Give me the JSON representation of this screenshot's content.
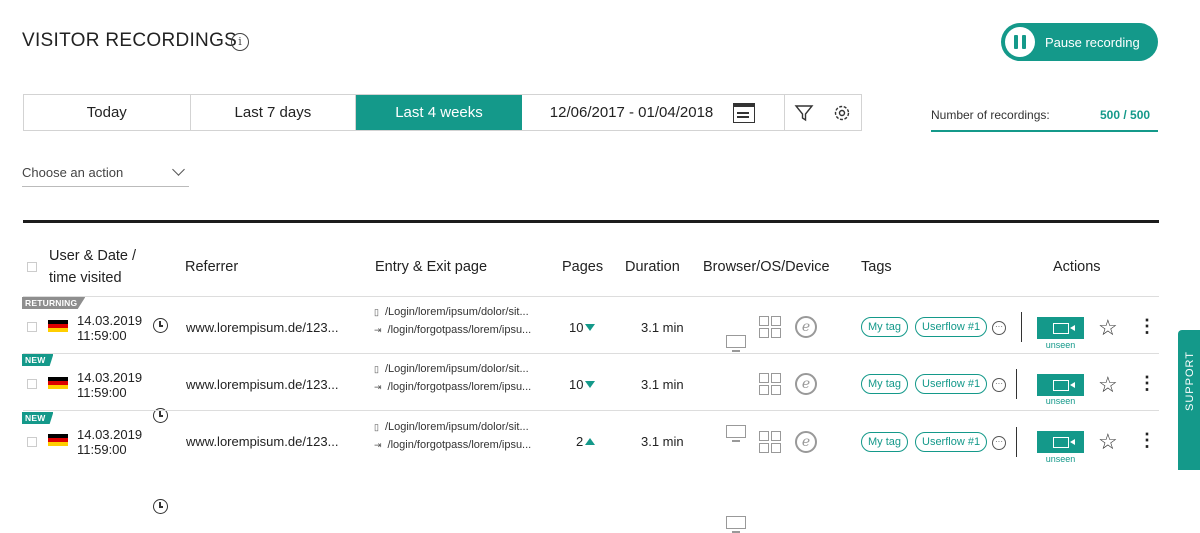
{
  "header": {
    "title": "VISITOR RECORDINGS",
    "info_icon": "i",
    "pause_label": "Pause recording"
  },
  "filters": {
    "today": "Today",
    "last7": "Last 7 days",
    "last4weeks": "Last 4 weeks",
    "date_range": "12/06/2017 - 01/04/2018",
    "active": "Last 4 weeks"
  },
  "recordings": {
    "label": "Number of recordings:",
    "value": "500 / 500"
  },
  "action_select": {
    "placeholder": "Choose an action"
  },
  "table": {
    "headers": {
      "user_date_line1": "User & Date /",
      "user_date_line2": "time visited",
      "referrer": "Referrer",
      "entry_exit": "Entry & Exit page",
      "pages": "Pages",
      "duration": "Duration",
      "browser": "Browser/OS/Device",
      "tags": "Tags",
      "actions": "Actions"
    },
    "rows": [
      {
        "badge": "RETURNING",
        "date": "14.03.2019",
        "time": "11:59:00",
        "referrer": "www.lorempisum.de/123...",
        "entry": "/Login/lorem/ipsum/dolor/sit...",
        "exit": "/login/forgotpass/lorem/ipsu...",
        "pages": "10",
        "trend": "down",
        "duration": "3.1 min",
        "tags": [
          "My tag",
          "Userflow #1"
        ],
        "status": "unseen"
      },
      {
        "badge": "NEW",
        "date": "14.03.2019",
        "time": "11:59:00",
        "referrer": "www.lorempisum.de/123...",
        "entry": "/Login/lorem/ipsum/dolor/sit...",
        "exit": "/login/forgotpass/lorem/ipsu...",
        "pages": "10",
        "trend": "down",
        "duration": "3.1 min",
        "tags": [
          "My tag",
          "Userflow #1"
        ],
        "status": "unseen"
      },
      {
        "badge": "NEW",
        "date": "14.03.2019",
        "time": "11:59:00",
        "referrer": "www.lorempisum.de/123...",
        "entry": "/Login/lorem/ipsum/dolor/sit...",
        "exit": "/login/forgotpass/lorem/ipsu...",
        "pages": "2",
        "trend": "up",
        "duration": "3.1 min",
        "tags": [
          "My tag",
          "Userflow #1"
        ],
        "status": "unseen"
      }
    ]
  },
  "support": "SUPPORT",
  "colors": {
    "accent": "#14998a",
    "returning_badge": "#8e8e8e"
  }
}
